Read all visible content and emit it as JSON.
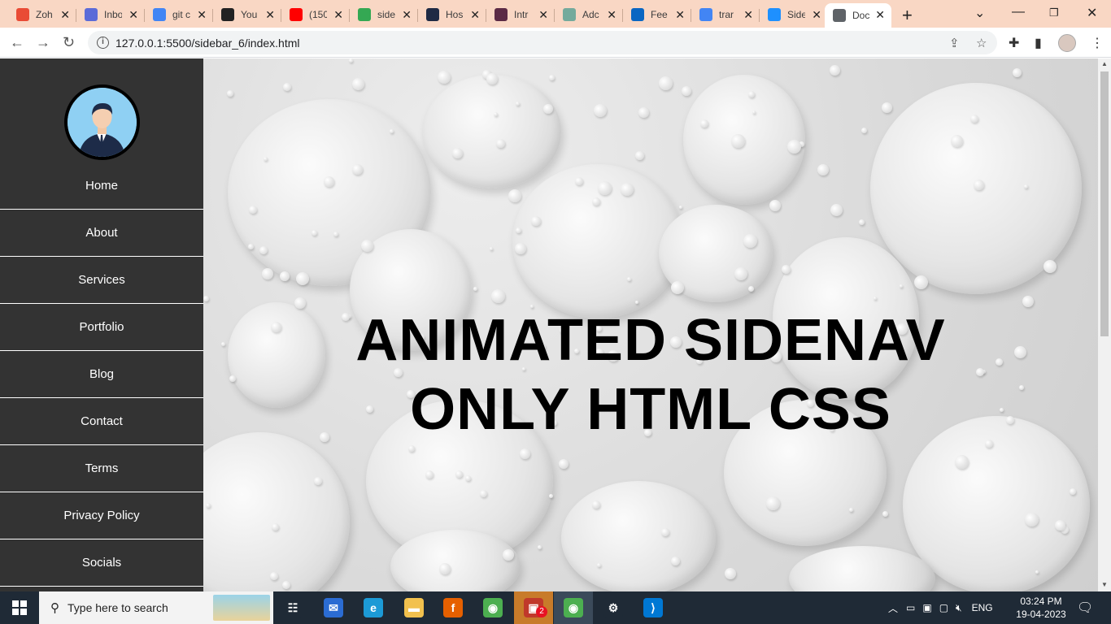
{
  "browser": {
    "tabs": [
      {
        "title": "Zoh",
        "icon": "zoho-icon",
        "color": "#e94b35"
      },
      {
        "title": "Inbo",
        "icon": "mail-icon",
        "color": "#5b6bd8"
      },
      {
        "title": "git c",
        "icon": "google-icon",
        "color": "#4285f4"
      },
      {
        "title": "You",
        "icon": "github-icon",
        "color": "#222222"
      },
      {
        "title": "(150",
        "icon": "youtube-icon",
        "color": "#ff0000"
      },
      {
        "title": "side",
        "icon": "drive-icon",
        "color": "#34a853"
      },
      {
        "title": "Hos",
        "icon": "hostinger-icon",
        "color": "#1f2a44"
      },
      {
        "title": "Intr",
        "icon": "chatgpt-icon",
        "color": "#5b2a45"
      },
      {
        "title": "Adc",
        "icon": "chatgpt-icon",
        "color": "#74aa9c"
      },
      {
        "title": "Fee",
        "icon": "linkedin-icon",
        "color": "#0a66c2"
      },
      {
        "title": "trar",
        "icon": "google-icon",
        "color": "#4285f4"
      },
      {
        "title": "Side",
        "icon": "codepen-icon",
        "color": "#1e90ff"
      },
      {
        "title": "Doc",
        "icon": "globe-icon",
        "color": "#5f6368"
      }
    ],
    "active_tab_index": 12,
    "url": "127.0.0.1:5500/sidebar_6/index.html"
  },
  "page": {
    "menu": [
      "Home",
      "About",
      "Services",
      "Portfolio",
      "Blog",
      "Contact",
      "Terms",
      "Privacy Policy",
      "Socials"
    ],
    "headline_line1": "ANIMATED SIDENAV",
    "headline_line2": "ONLY HTML CSS"
  },
  "taskbar": {
    "search_placeholder": "Type here to search",
    "apps": [
      {
        "name": "task-view-icon",
        "color": "#1f2a36"
      },
      {
        "name": "mail-app-icon",
        "color": "#2b6cd3"
      },
      {
        "name": "edge-icon",
        "color": "#1c9ad6"
      },
      {
        "name": "file-explorer-icon",
        "color": "#f2c14e"
      },
      {
        "name": "firefox-icon",
        "color": "#e66000"
      },
      {
        "name": "chrome-icon",
        "color": "#4caf50"
      },
      {
        "name": "chat-app-icon",
        "color": "#c0392b"
      },
      {
        "name": "chrome-active-icon",
        "color": "#4caf50"
      },
      {
        "name": "settings-icon",
        "color": "#1f2a36"
      },
      {
        "name": "vscode-icon",
        "color": "#0078d4"
      }
    ],
    "chat_badge": "2",
    "language": "ENG",
    "time": "03:24 PM",
    "date": "19-04-2023"
  }
}
